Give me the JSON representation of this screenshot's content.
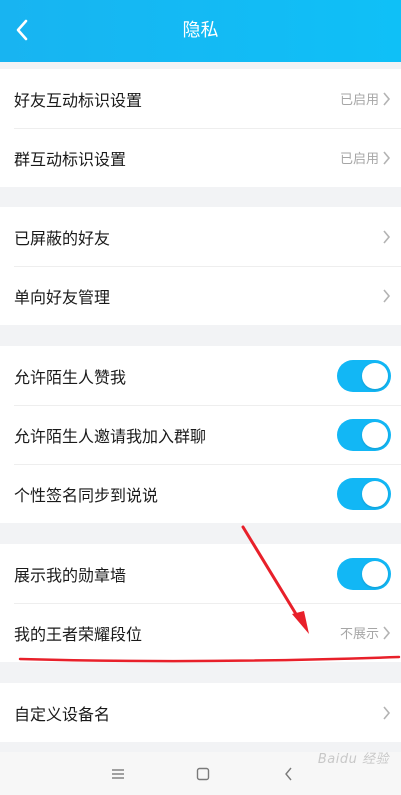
{
  "header": {
    "title": "隐私",
    "accent_color": "#12b7f5"
  },
  "groups": [
    {
      "rows": [
        {
          "label": "好友互动标识设置",
          "status": "已启用"
        },
        {
          "label": "群互动标识设置",
          "status": "已启用"
        }
      ]
    },
    {
      "rows": [
        {
          "label": "已屏蔽的好友"
        },
        {
          "label": "单向好友管理"
        }
      ]
    },
    {
      "rows": [
        {
          "label": "允许陌生人赞我",
          "toggle_on": true
        },
        {
          "label": "允许陌生人邀请我加入群聊",
          "toggle_on": true
        },
        {
          "label": "个性签名同步到说说",
          "toggle_on": true
        }
      ]
    },
    {
      "rows": [
        {
          "label": "展示我的勋章墙",
          "toggle_on": true
        },
        {
          "label": "我的王者荣耀段位",
          "status": "不展示"
        }
      ]
    },
    {
      "rows": [
        {
          "label": "自定义设备名"
        }
      ]
    }
  ],
  "annotation": {
    "color": "#e8202a"
  },
  "navbar": {
    "icons": [
      "menu-icon",
      "home-square-icon",
      "back-chevron-icon"
    ]
  },
  "watermark": {
    "text": "Baidu 经验"
  }
}
